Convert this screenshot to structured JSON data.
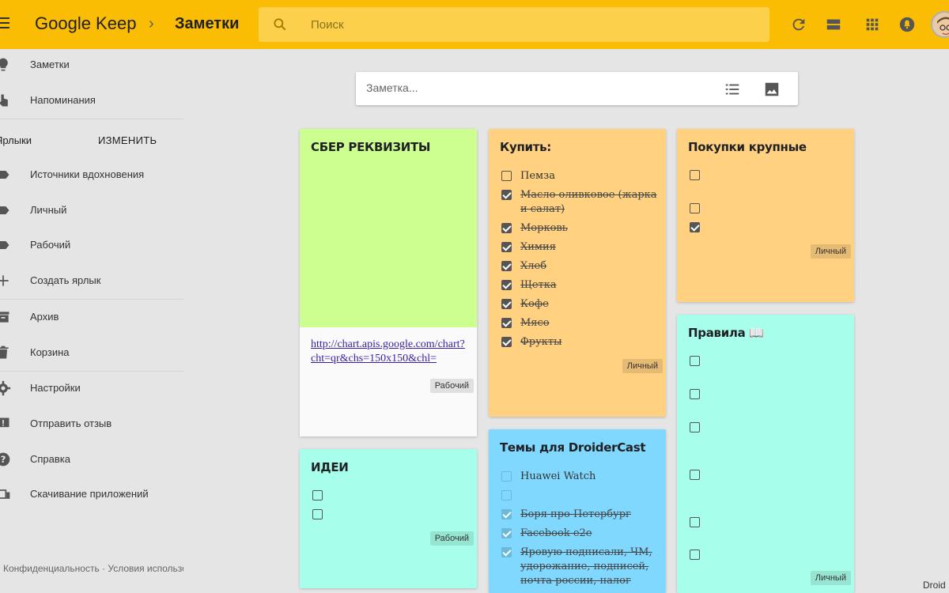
{
  "header": {
    "app_name": "Google Keep",
    "breadcrumb_arrow": "›",
    "section_title": "Заметки",
    "search_placeholder": "Поиск"
  },
  "sidebar": {
    "items": [
      {
        "label": "Заметки",
        "icon": "bulb-icon"
      },
      {
        "label": "Напоминания",
        "icon": "reminder-icon"
      }
    ],
    "labels_heading": "Ярлыки",
    "labels_edit": "ИЗМЕНИТЬ",
    "labels": [
      {
        "label": "Источники вдохновения",
        "icon": "label-icon"
      },
      {
        "label": "Личный",
        "icon": "label-icon"
      },
      {
        "label": "Рабочий",
        "icon": "label-icon"
      },
      {
        "label": "Создать ярлык",
        "icon": "plus-icon"
      }
    ],
    "bottom_items": [
      {
        "label": "Архив",
        "icon": "archive-icon"
      },
      {
        "label": "Корзина",
        "icon": "trash-icon"
      },
      {
        "label": "Настройки",
        "icon": "gear-icon"
      },
      {
        "label": "Отправить отзыв",
        "icon": "feedback-icon"
      },
      {
        "label": "Справка",
        "icon": "help-icon"
      },
      {
        "label": "Скачивание приложений",
        "icon": "devices-icon"
      }
    ],
    "footer": "Конфиденциальность · Условия использования"
  },
  "take_note": {
    "placeholder": "Заметка..."
  },
  "notes": {
    "sber": {
      "title": "СБЕР РЕКВИЗИТЫ",
      "link": "http://chart.apis.google.com/chart?cht=qr&chs=150x150&chl=",
      "label": "Рабочий",
      "color": "#ccff90"
    },
    "ideas": {
      "title": "ИДЕИ",
      "label": "Рабочий",
      "items": [
        {
          "text": "",
          "checked": false
        },
        {
          "text": "",
          "checked": false
        }
      ],
      "color": "#a7ffeb"
    },
    "buy": {
      "title": "Купить:",
      "label": "Личный",
      "color": "#ffd180",
      "items": [
        {
          "text": "Пемза",
          "checked": false
        },
        {
          "text": "Масло оливковое (жарка и салат)",
          "checked": true
        },
        {
          "text": "Морковь",
          "checked": true
        },
        {
          "text": "Химия",
          "checked": true
        },
        {
          "text": "Хлеб",
          "checked": true
        },
        {
          "text": "Щетка",
          "checked": true
        },
        {
          "text": "Кофе",
          "checked": true
        },
        {
          "text": "Мясо",
          "checked": true
        },
        {
          "text": "Фрукты",
          "checked": true
        }
      ]
    },
    "droidercast": {
      "title": "Темы для DroiderCast",
      "color": "#80d8ff",
      "items": [
        {
          "text": "Huawei Watch",
          "checked": false
        },
        {
          "text": "",
          "checked": false
        },
        {
          "text": "Боря про Петербург",
          "checked": true
        },
        {
          "text": "Facebook e2e",
          "checked": true
        },
        {
          "text": "Яровую подписали, ЧМ, удорожание, подписей, почта россии, налог",
          "checked": true
        }
      ]
    },
    "big_purchases": {
      "title": "Покупки крупные",
      "label": "Личный",
      "color": "#ffd180"
    },
    "rules": {
      "title": "Правила 📖",
      "label": "Личный",
      "color": "#a7ffeb"
    }
  },
  "corner_text": "Droid"
}
